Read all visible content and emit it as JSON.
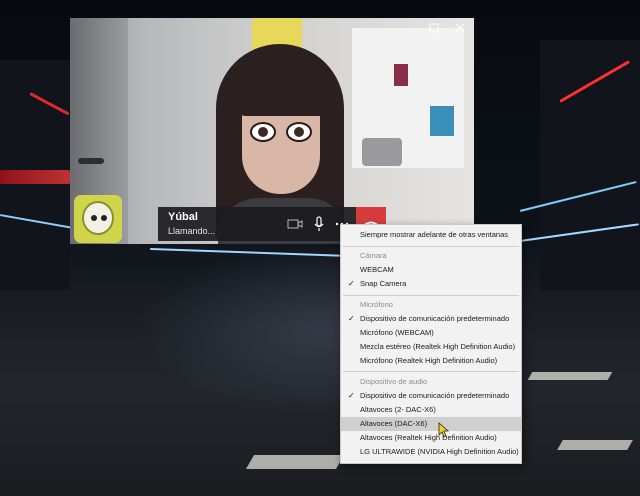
{
  "call": {
    "caller_name": "Yúbal",
    "status": "Llamando..."
  },
  "window_controls": [
    "restore-icon",
    "close-icon"
  ],
  "bar_icons": [
    "video-camera-icon",
    "microphone-icon",
    "more-icon",
    "hang-up-icon"
  ],
  "colors": {
    "hangup": "#d83b3b",
    "menu_bg": "#f2f2f2",
    "highlight": "#cfcfcf"
  },
  "menu": {
    "always_on_top": "Siempre mostrar adelante de otras ventanas",
    "camera": {
      "header": "Cámara",
      "items": [
        {
          "label": "WEBCAM",
          "checked": false
        },
        {
          "label": "Snap Camera",
          "checked": true
        }
      ]
    },
    "microphone": {
      "header": "Micrófono",
      "items": [
        {
          "label": "Dispositivo de comunicación predeterminado",
          "checked": true
        },
        {
          "label": "Micrófono (WEBCAM)",
          "checked": false
        },
        {
          "label": "Mezcla estéreo (Realtek High Definition Audio)",
          "checked": false
        },
        {
          "label": "Micrófono (Realtek High Definition Audio)",
          "checked": false
        }
      ]
    },
    "audio": {
      "header": "Dispositivo de audio",
      "items": [
        {
          "label": "Dispositivo de comunicación predeterminado",
          "checked": true
        },
        {
          "label": "Altavoces (2- DAC-X6)",
          "checked": false
        },
        {
          "label": "Altavoces (DAC-X6)",
          "checked": false,
          "hovered": true
        },
        {
          "label": "Altavoces (Realtek High Definition Audio)",
          "checked": false
        },
        {
          "label": "LG ULTRAWIDE (NVIDIA High Definition Audio)",
          "checked": false
        }
      ]
    }
  }
}
